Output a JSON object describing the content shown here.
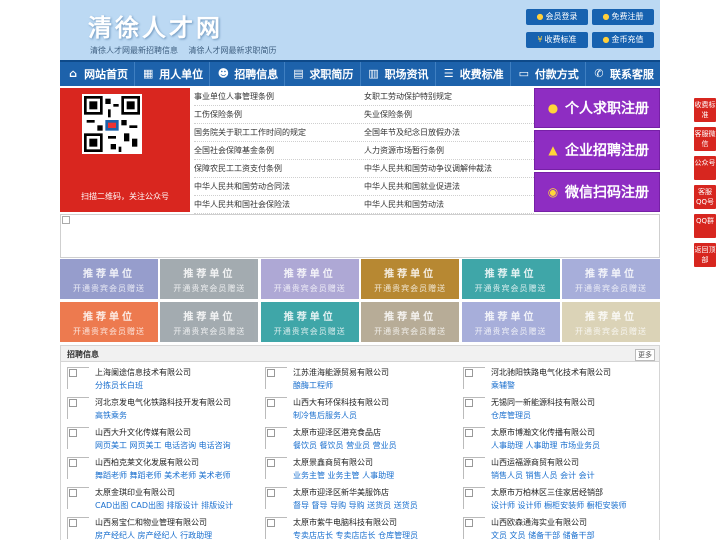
{
  "header": {
    "logo": "清徐人才网",
    "slogan": [
      "清徐人才网最新招聘信息",
      "清徐人才网最新求职简历"
    ],
    "buttons": [
      "会员登录",
      "免费注册",
      "收费标准",
      "金币充值"
    ]
  },
  "nav": [
    "网站首页",
    "用人单位",
    "招聘信息",
    "求职简历",
    "职场资讯",
    "收费标准",
    "付款方式",
    "联系客服"
  ],
  "qr_caption": "扫描二维码，关注公众号",
  "laws": [
    [
      "事业单位人事管理条例",
      "女职工劳动保护特别规定"
    ],
    [
      "工伤保险条例",
      "失业保险条例"
    ],
    [
      "国务院关于职工工作时间的规定",
      "全国年节及纪念日放假办法"
    ],
    [
      "全国社会保障基金条例",
      "人力资源市场暂行条例"
    ],
    [
      "保障农民工工资支付条例",
      "中华人民共和国劳动争议调解仲裁法"
    ],
    [
      "中华人民共和国劳动合同法",
      "中华人民共和国就业促进法"
    ],
    [
      "中华人民共和国社会保险法",
      "中华人民共和国劳动法"
    ]
  ],
  "register": [
    "个人求职注册",
    "企业招聘注册",
    "微信扫码注册"
  ],
  "tiles": {
    "line1": "推荐单位",
    "line2": "开通贵宾会员赠送",
    "colors": [
      "#8b93c7",
      "#9aa3a8",
      "#a69fd1",
      "#b07c1c",
      "#2b9d9f",
      "#9ea6d6",
      "#ec6c3c",
      "#9aa3a8",
      "#2b9d9f",
      "#b0a48c",
      "#9ea6d6",
      "#d8cfb0"
    ]
  },
  "jobs": {
    "title": "招聘信息",
    "more": "更多",
    "items": [
      {
        "name": "上海阑途信息技术有限公司",
        "pos": "分拣员长白班"
      },
      {
        "name": "江苏淮海能源贸易有限公司",
        "pos": "酿酶工程师"
      },
      {
        "name": "河北驰阳铁路电气化技术有限公司",
        "pos": "乘辅警"
      },
      {
        "name": "河北京发电气化铁路科技开发有限公司",
        "pos": "高铁乘务"
      },
      {
        "name": "山西大有环保科技有限公司",
        "pos": "制冷售后服务人员"
      },
      {
        "name": "无锡同一新能源科技有限公司",
        "pos": "仓库管理员"
      },
      {
        "name": "山西大升文化传媒有限公司",
        "pos": "网页美工 网页美工 电话咨询 电话咨询"
      },
      {
        "name": "太原市迎泽区港充食品店",
        "pos": "餐饮员 餐饮员 营业员 营业员"
      },
      {
        "name": "太原市博瀚文化传播有限公司",
        "pos": "人事助理 人事助理 市场业务员"
      },
      {
        "name": "山西柏克莱文化发展有限公司",
        "pos": "舞蹈老师 舞蹈老师 美术老师 美术老师"
      },
      {
        "name": "太原景鑫商贸有限公司",
        "pos": "业务主管 业务主管 人事助理"
      },
      {
        "name": "山西运福源商贸有限公司",
        "pos": "销售人员 销售人员 会计 会计"
      },
      {
        "name": "太原金琪印业有限公司",
        "pos": "CAD出图 CAD出图 排版设计 排版设计"
      },
      {
        "name": "太原市迎泽区新华美服饰店",
        "pos": "督导 督导 导购 导购 送货员 送货员"
      },
      {
        "name": "太原市万柏林区三佳家居经销部",
        "pos": "设计师 设计师 橱柜安装师 橱柜安装师"
      },
      {
        "name": "山西易宝仁和物业管理有限公司",
        "pos": "房产经纪人 房产经纪人 行政助理"
      },
      {
        "name": "太原市紫牛电脑科技有限公司",
        "pos": "专卖店店长 专卖店店长 仓库管理员"
      },
      {
        "name": "山西欧森通海实业有限公司",
        "pos": "文员 文员 储备干部 储备干部"
      }
    ]
  },
  "float": [
    "收费标准",
    "客服微信",
    "公众号",
    "客服QQ号",
    "QQ群",
    "返回顶部"
  ],
  "colors": {
    "nav": "#1d62ab",
    "qr_bg": "#d9261f",
    "register": "#8e2dc2",
    "link": "#1a6fce",
    "float": "#d7261f"
  }
}
